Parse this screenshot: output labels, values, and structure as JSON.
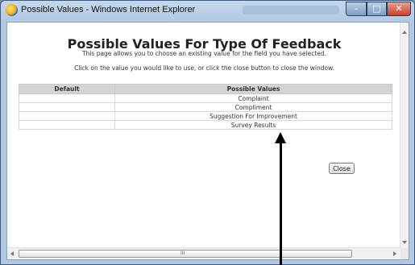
{
  "window": {
    "title": "Possible Values - Windows Internet Explorer",
    "controls": {
      "minimize": "–",
      "maximize": "□",
      "close": "✕"
    }
  },
  "page": {
    "heading": "Possible Values For Type Of Feedback",
    "subtitle": "This page allows you to choose an existing value for the field you have selected.",
    "instruction": "Click on the value you would like to use, or click the close button to close the window."
  },
  "table": {
    "headers": [
      "Default",
      "Possible Values"
    ],
    "rows": [
      {
        "default": "",
        "value": "Complaint"
      },
      {
        "default": "",
        "value": "Compliment"
      },
      {
        "default": "",
        "value": "Suggestion For Improvement"
      },
      {
        "default": "",
        "value": "Survey Results"
      }
    ]
  },
  "close_button": {
    "label": "Close"
  },
  "scrollbar": {
    "grip": "III"
  },
  "colors": {
    "header_bg": "#d4d4d4",
    "titlebar": "#b3c9e2",
    "close_ctrl": "#c7402a"
  }
}
